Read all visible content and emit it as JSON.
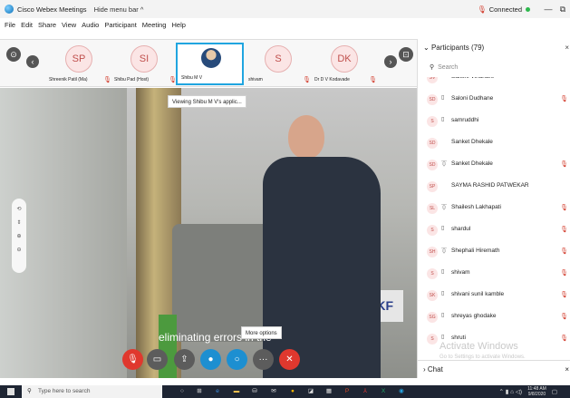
{
  "titlebar": {
    "app_title": "Cisco Webex Meetings",
    "hide_menu": "Hide menu bar ^",
    "status": "Connected",
    "minimize": "—",
    "restore": "⧉"
  },
  "menu": {
    "items": [
      "File",
      "Edit",
      "Share",
      "View",
      "Audio",
      "Participant",
      "Meeting",
      "Help"
    ]
  },
  "thumbnails": [
    {
      "initials": "SP",
      "label": "Shreenik Patil (Ma)"
    },
    {
      "initials": "SI",
      "label": "Shibu Pad (Host)"
    },
    {
      "initials": "",
      "label": "Shibu M V"
    },
    {
      "initials": "S",
      "label": "shivam"
    },
    {
      "initials": "DK",
      "label": "Dr D V Kodavade"
    }
  ],
  "video": {
    "viewing_label": "Viewing Shibu M V's applic...",
    "caption": "eliminating errors in the",
    "more_options_tip": "More options",
    "side_controls": [
      "⟲",
      "⇕",
      "⊕",
      "⊖"
    ]
  },
  "controls": {
    "more": "···",
    "end": "✕"
  },
  "panel": {
    "title": "Participants (79)",
    "search_placeholder": "Search",
    "participants": [
      {
        "initials": "SV",
        "name": "Sakshi Vihahare",
        "device": "",
        "muted": false
      },
      {
        "initials": "SD",
        "name": "Saloni Dudhane",
        "device": "▯",
        "muted": true
      },
      {
        "initials": "S",
        "name": "samruddhi",
        "device": "▯",
        "muted": false
      },
      {
        "initials": "SD",
        "name": "Sanket Dhekale",
        "device": "",
        "muted": false
      },
      {
        "initials": "SD",
        "name": "Sanket Dhekale",
        "device": "⏁",
        "muted": true
      },
      {
        "initials": "SP",
        "name": "SAYMA RASHID PATWEKAR",
        "device": "",
        "muted": false
      },
      {
        "initials": "SL",
        "name": "Shailesh Lakhapati",
        "device": "⏁",
        "muted": true
      },
      {
        "initials": "S",
        "name": "shardul",
        "device": "▯",
        "muted": true
      },
      {
        "initials": "SH",
        "name": "Shephali Hiremath",
        "device": "⏁",
        "muted": true
      },
      {
        "initials": "S",
        "name": "shivam",
        "device": "▯",
        "muted": true
      },
      {
        "initials": "SK",
        "name": "shivani sunil kamble",
        "device": "▯",
        "muted": true
      },
      {
        "initials": "SG",
        "name": "shreyas ghodake",
        "device": "▯",
        "muted": true
      },
      {
        "initials": "S",
        "name": "shruti",
        "device": "▯",
        "muted": true
      }
    ],
    "chat_label": "Chat",
    "activate_title": "Activate Windows",
    "activate_sub": "Go to Settings to activate Windows."
  },
  "taskbar": {
    "search_placeholder": "Type here to search",
    "time": "11:48 AM",
    "date": "9/8/2020"
  },
  "colors": {
    "accent": "#1d8fd1",
    "mute_red": "#e0382e",
    "connected_green": "#2db84d"
  }
}
